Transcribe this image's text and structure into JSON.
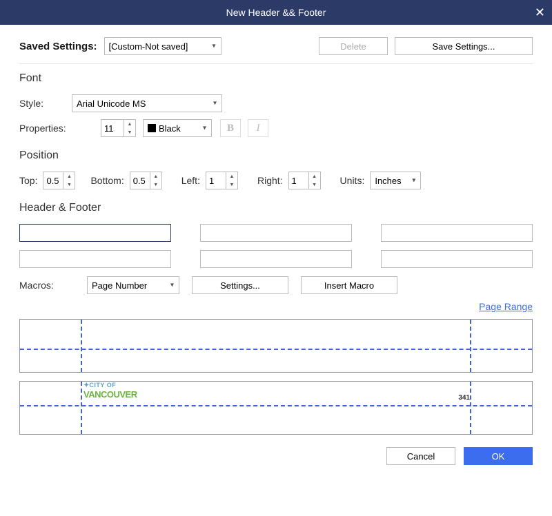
{
  "title": "New Header && Footer",
  "savedSettings": {
    "label": "Saved Settings:",
    "value": "[Custom-Not saved]",
    "deleteLabel": "Delete",
    "saveLabel": "Save Settings..."
  },
  "font": {
    "header": "Font",
    "styleLabel": "Style:",
    "styleValue": "Arial Unicode MS",
    "propsLabel": "Properties:",
    "sizeValue": "11",
    "colorValue": "Black"
  },
  "position": {
    "header": "Position",
    "topLabel": "Top:",
    "topValue": "0.5",
    "bottomLabel": "Bottom:",
    "bottomValue": "0.5",
    "leftLabel": "Left:",
    "leftValue": "1",
    "rightLabel": "Right:",
    "rightValue": "1",
    "unitsLabel": "Units:",
    "unitsValue": "Inches"
  },
  "headerFooter": {
    "header": "Header & Footer",
    "macrosLabel": "Macros:",
    "macrosValue": "Page Number",
    "settingsLabel": "Settings...",
    "insertLabel": "Insert Macro",
    "pageRangeLabel": "Page Range"
  },
  "preview": {
    "logoLine1": "CITY OF",
    "logoLine2": "VANCOUVER",
    "pageNum": "341"
  },
  "buttons": {
    "cancel": "Cancel",
    "ok": "OK"
  }
}
